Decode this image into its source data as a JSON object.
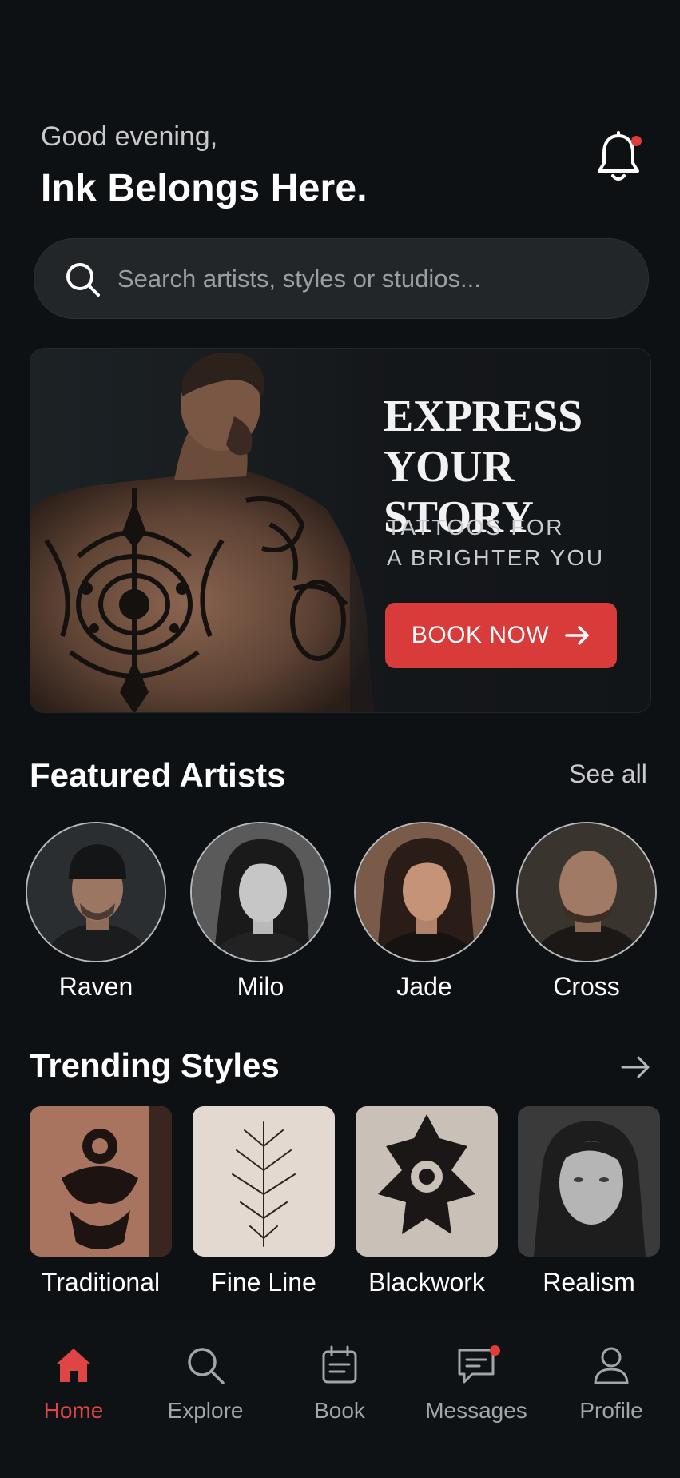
{
  "header": {
    "greeting": "Good evening,",
    "headline": "Ink Belongs Here.",
    "notification_icon": "bell-icon",
    "has_unread_notifications": true
  },
  "search": {
    "placeholder": "Search artists, styles or studios..."
  },
  "hero": {
    "title_line1": "EXPRESS",
    "title_line2": "YOUR STORY",
    "subtitle_line1": "TATTOOS FOR",
    "subtitle_line2": "A BRIGHTER YOU",
    "cta_label": "BOOK NOW",
    "cta_icon": "arrow-right-icon"
  },
  "featured_artists": {
    "title": "Featured Artists",
    "see_all_label": "See all",
    "artists": [
      {
        "name": "Raven"
      },
      {
        "name": "Milo"
      },
      {
        "name": "Jade"
      },
      {
        "name": "Cross"
      }
    ]
  },
  "trending_styles": {
    "title": "Trending Styles",
    "arrow_icon": "arrow-right-icon",
    "styles": [
      {
        "name": "Traditional"
      },
      {
        "name": "Fine Line"
      },
      {
        "name": "Blackwork"
      },
      {
        "name": "Realism"
      }
    ]
  },
  "tabbar": {
    "active": "Home",
    "tabs": [
      {
        "label": "Home",
        "icon": "home-icon"
      },
      {
        "label": "Explore",
        "icon": "search-icon"
      },
      {
        "label": "Book",
        "icon": "calendar-icon"
      },
      {
        "label": "Messages",
        "icon": "chat-icon"
      },
      {
        "label": "Profile",
        "icon": "user-icon"
      }
    ]
  },
  "colors": {
    "background": "#0e1114",
    "accent": "#d93a3a",
    "card": "#222629",
    "muted_text": "#a3a6a9"
  }
}
